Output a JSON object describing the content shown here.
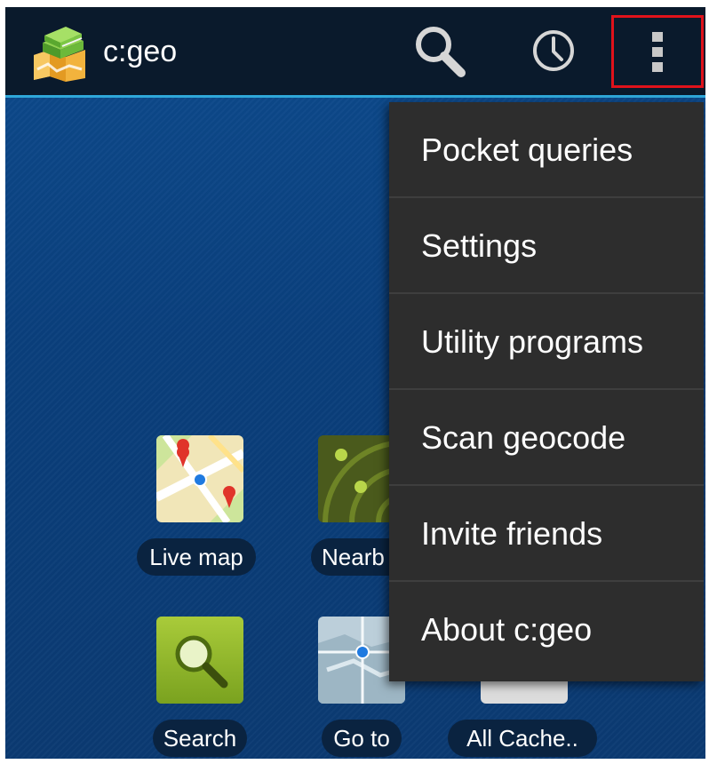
{
  "app": {
    "title": "c:geo",
    "logo_icon": "c-geo-map-logo-icon"
  },
  "action_bar": {
    "search_icon": "search-icon",
    "history_icon": "clock-icon",
    "overflow_icon": "more-vert-icon",
    "accent_color": "#2fa7d9",
    "highlight_color": "#e0121b"
  },
  "home_grid": [
    {
      "label": "Live map",
      "icon": "live-map-icon"
    },
    {
      "label": "Nearb",
      "icon": "nearby-radar-icon"
    },
    {
      "label": "Search",
      "icon": "search-magnifier-icon"
    },
    {
      "label": "Go to",
      "icon": "go-to-map-icon"
    },
    {
      "label": "All Cache..",
      "icon": "all-caches-icon"
    }
  ],
  "overflow_menu": {
    "items": [
      {
        "label": "Pocket queries"
      },
      {
        "label": "Settings"
      },
      {
        "label": "Utility programs"
      },
      {
        "label": "Scan geocode"
      },
      {
        "label": "Invite friends"
      },
      {
        "label": "About c:geo"
      }
    ]
  }
}
